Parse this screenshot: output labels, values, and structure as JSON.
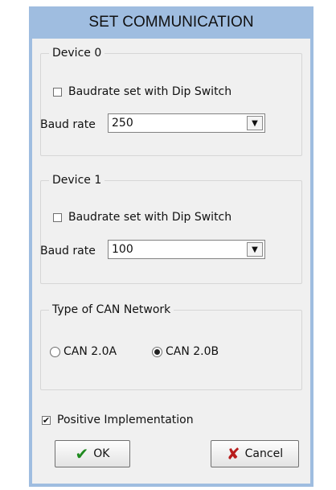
{
  "window": {
    "title": "SET COMMUNICATION"
  },
  "device0": {
    "legend": "Device 0",
    "dip_label": "Baudrate set with Dip Switch",
    "dip_checked": false,
    "baud_label": "Baud rate",
    "baud_value": "250"
  },
  "device1": {
    "legend": "Device 1",
    "dip_label": "Baudrate set with Dip Switch",
    "dip_checked": false,
    "baud_label": "Baud rate",
    "baud_value": "100"
  },
  "network": {
    "legend": "Type of CAN Network",
    "option_a": "CAN 2.0A",
    "option_b": "CAN 2.0B",
    "selected": "CAN 2.0B"
  },
  "positive": {
    "label": "Positive Implementation",
    "checked": true
  },
  "buttons": {
    "ok": "OK",
    "cancel": "Cancel"
  },
  "icons": {
    "ok": "checkmark-icon",
    "cancel": "x-mark-icon",
    "dropdown": "chevron-down-icon"
  },
  "colors": {
    "frame": "#9fbde0",
    "client": "#f0f0f0",
    "ok_icon": "#1f8a1f",
    "cancel_icon": "#b81c1c"
  }
}
